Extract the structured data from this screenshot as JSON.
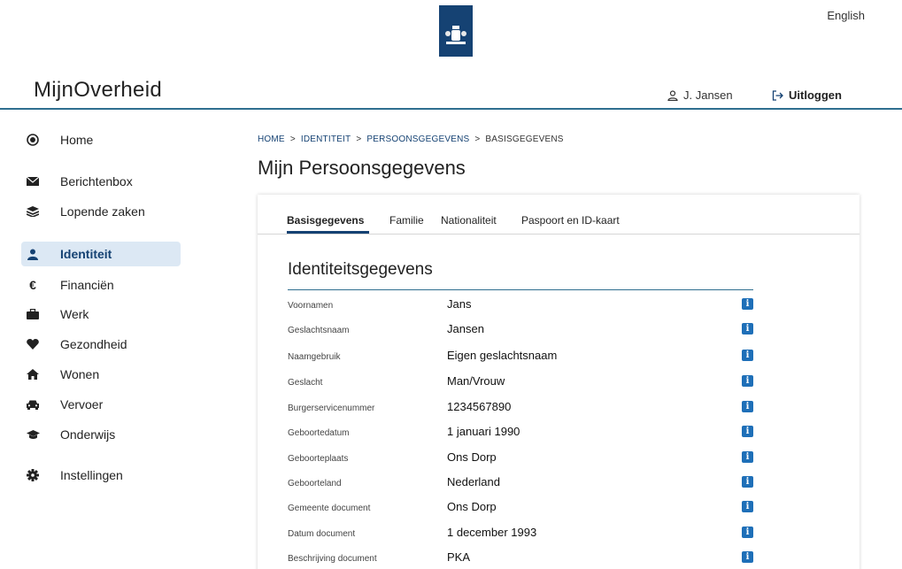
{
  "header": {
    "language": "English",
    "brand": "MijnOverheid",
    "user_name": "J. Jansen",
    "logout_label": "Uitloggen"
  },
  "colors": {
    "primary": "#154273",
    "accent_line": "#2f6f8f",
    "active_nav_bg": "#dce8f4",
    "info_icon": "#1e6fb8"
  },
  "sidebar": {
    "items": [
      {
        "label": "Home",
        "icon": "home-target-icon"
      },
      {
        "label": "Berichtenbox",
        "icon": "envelope-icon"
      },
      {
        "label": "Lopende zaken",
        "icon": "layers-icon"
      },
      {
        "label": "Identiteit",
        "icon": "person-icon",
        "active": true
      },
      {
        "label": "Financiën",
        "icon": "euro-icon"
      },
      {
        "label": "Werk",
        "icon": "briefcase-icon"
      },
      {
        "label": "Gezondheid",
        "icon": "heart-icon"
      },
      {
        "label": "Wonen",
        "icon": "house-icon"
      },
      {
        "label": "Vervoer",
        "icon": "car-icon"
      },
      {
        "label": "Onderwijs",
        "icon": "graduation-cap-icon"
      },
      {
        "label": "Instellingen",
        "icon": "gear-icon"
      }
    ]
  },
  "breadcrumb": {
    "items": [
      "HOME",
      "IDENTITEIT",
      "PERSOONSGEGEVENS",
      "BASISGEGEVENS"
    ],
    "separator": ">"
  },
  "page_title": "Mijn Persoonsgegevens",
  "tabs": [
    {
      "label": "Basisgegevens",
      "active": true
    },
    {
      "label": "Familie"
    },
    {
      "label": "Nationaliteit"
    },
    {
      "label": "Paspoort en ID-kaart"
    }
  ],
  "section": {
    "title": "Identiteitsgegevens",
    "info_glyph": "i",
    "rows": [
      {
        "label": "Voornamen",
        "value": "Jans"
      },
      {
        "label": "Geslachtsnaam",
        "value": "Jansen"
      },
      {
        "label": "Naamgebruik",
        "value": "Eigen geslachtsnaam"
      },
      {
        "label": "Geslacht",
        "value": "Man/Vrouw"
      },
      {
        "label": "Burgerservicenummer",
        "value": "1234567890"
      },
      {
        "label": "Geboortedatum",
        "value": "1 januari 1990"
      },
      {
        "label": "Geboorteplaats",
        "value": "Ons Dorp"
      },
      {
        "label": "Geboorteland",
        "value": "Nederland"
      },
      {
        "label": "Gemeente document",
        "value": "Ons Dorp"
      },
      {
        "label": "Datum document",
        "value": "1 december 1993"
      },
      {
        "label": "Beschrijving document",
        "value": "PKA"
      }
    ]
  }
}
